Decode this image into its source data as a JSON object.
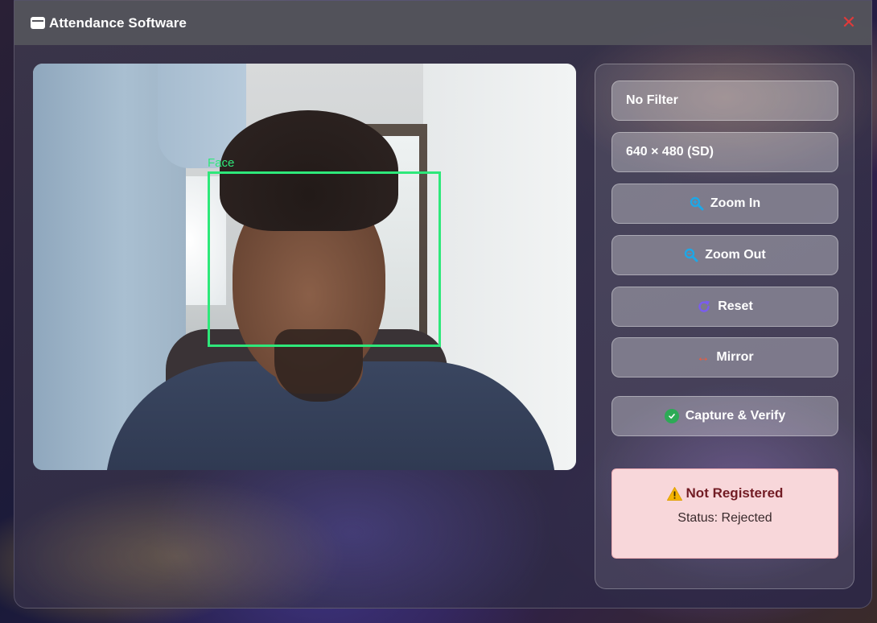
{
  "window": {
    "title": "Attendance Software",
    "close_icon": "close-icon",
    "app_icon": "window-icon"
  },
  "camera": {
    "face_label": "Face",
    "face_box_color": "#2ee87a"
  },
  "controls": {
    "filter_select": {
      "value": "No Filter"
    },
    "resolution_select": {
      "value": "640 × 480 (SD)"
    },
    "zoom_in": {
      "label": "Zoom In",
      "icon": "zoom-in-icon",
      "color": "#1ea7e6"
    },
    "zoom_out": {
      "label": "Zoom Out",
      "icon": "zoom-out-icon",
      "color": "#1ea7e6"
    },
    "reset": {
      "label": "Reset",
      "icon": "reset-icon",
      "color": "#7a5cf0"
    },
    "mirror": {
      "label": "Mirror",
      "icon": "mirror-icon",
      "color": "#f05a3a"
    },
    "capture": {
      "label": "Capture & Verify",
      "icon": "check-circle-icon",
      "color": "#2daa56"
    }
  },
  "result": {
    "title": "Not Registered",
    "status": "Status: Rejected",
    "icon": "warning-icon",
    "background": "#f8d7da"
  }
}
